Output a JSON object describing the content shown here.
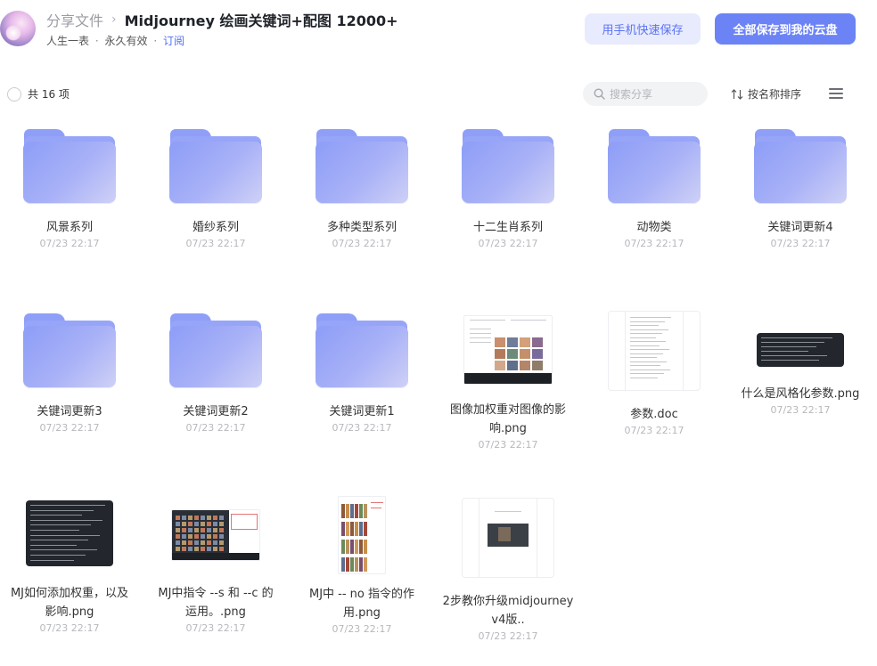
{
  "header": {
    "breadcrumb_root": "分享文件",
    "breadcrumb_sep": "›",
    "title": "Midjourney 绘画关键词+配图 12000+",
    "owner": "人生一表",
    "sep": "·",
    "validity": "永久有效",
    "subscribe": "订阅",
    "mobile_save_label": "用手机快速保存",
    "save_all_label": "全部保存到我的云盘"
  },
  "toolbar": {
    "count_label": "共 16 项",
    "search_placeholder": "搜索分享",
    "sort_label": "按名称排序"
  },
  "items": [
    {
      "name": "风景系列",
      "date": "07/23 22:17",
      "type": "folder"
    },
    {
      "name": "婚纱系列",
      "date": "07/23 22:17",
      "type": "folder"
    },
    {
      "name": "多种类型系列",
      "date": "07/23 22:17",
      "type": "folder"
    },
    {
      "name": "十二生肖系列",
      "date": "07/23 22:17",
      "type": "folder"
    },
    {
      "name": "动物类",
      "date": "07/23 22:17",
      "type": "folder"
    },
    {
      "name": "关键词更新4",
      "date": "07/23 22:17",
      "type": "folder"
    },
    {
      "name": "关键词更新3",
      "date": "07/23 22:17",
      "type": "folder"
    },
    {
      "name": "关键词更新2",
      "date": "07/23 22:17",
      "type": "folder"
    },
    {
      "name": "关键词更新1",
      "date": "07/23 22:17",
      "type": "folder"
    },
    {
      "name": "图像加权重对图像的影响.png",
      "date": "07/23 22:17",
      "type": "png"
    },
    {
      "name": "参数.doc",
      "date": "07/23 22:17",
      "type": "doc"
    },
    {
      "name": "什么是风格化参数.png",
      "date": "07/23 22:17",
      "type": "png"
    },
    {
      "name": "MJ如何添加权重，以及影响.png",
      "date": "07/23 22:17",
      "type": "png"
    },
    {
      "name": "MJ中指令 --s 和 --c 的运用。.png",
      "date": "07/23 22:17",
      "type": "png"
    },
    {
      "name": "MJ中 -- no 指令的作用.png",
      "date": "07/23 22:17",
      "type": "png"
    },
    {
      "name": "2步教你升级midjourney v4版..",
      "date": "07/23 22:17",
      "type": "png"
    }
  ],
  "colors": {
    "accent": "#6c83f6",
    "accent_light": "#e8ebfd",
    "folder": "#97a5f8"
  }
}
